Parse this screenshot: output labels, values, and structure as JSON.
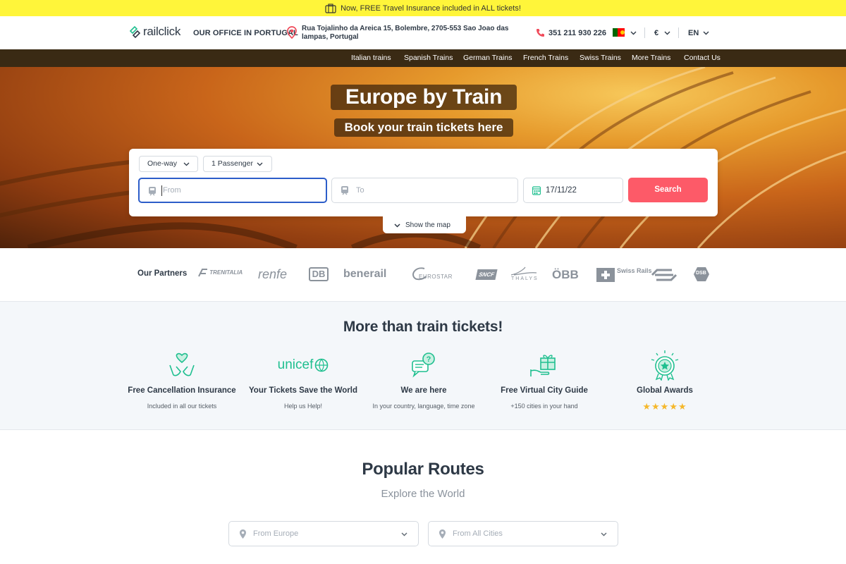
{
  "promo": {
    "text": "Now, FREE Travel Insurance included in ALL tickets!"
  },
  "header": {
    "logo": "railclick",
    "office_label": "OUR OFFICE IN PORTUGAL",
    "office_address": "Rua Tojalinho da Areica 15, Bolembre, 2705-553 Sao Joao das lampas, Portugal",
    "phone": "351 211 930 226",
    "currency": "€",
    "language": "EN"
  },
  "nav": {
    "items": [
      "Italian trains",
      "Spanish Trains",
      "German Trains",
      "French Trains",
      "Swiss Trains",
      "More Trains",
      "Contact Us"
    ]
  },
  "hero": {
    "title": "Europe by Train",
    "subtitle": "Book your train tickets here"
  },
  "search": {
    "trip_type": "One-way",
    "passengers": "1 Passenger",
    "from_placeholder": "From",
    "to_placeholder": "To",
    "date": "17/11/22",
    "button": "Search",
    "show_map": "Show the map"
  },
  "partners": {
    "label": "Our Partners",
    "logos": [
      "TRENITALIA",
      "renfe",
      "DB",
      "benerail",
      "EUROSTAR",
      "SNCF",
      "THALYS",
      "ÖBB",
      "Swiss Rails",
      "NS",
      "DSB"
    ]
  },
  "features": {
    "title": "More than train tickets!",
    "items": [
      {
        "title": "Free Cancellation Insurance",
        "subtitle": "Included in all our tickets",
        "icon": "hands-heart-icon"
      },
      {
        "title": "Your Tickets Save the World",
        "subtitle": "Help us Help!",
        "icon": "unicef-logo"
      },
      {
        "title": "We are here",
        "subtitle": "In your country, language, time zone",
        "icon": "chat-question-icon"
      },
      {
        "title": "Free Virtual City Guide",
        "subtitle": "+150 cities in your hand",
        "icon": "gift-hand-icon"
      },
      {
        "title": "Global Awards",
        "subtitle": "",
        "icon": "award-icon",
        "rating": 5
      }
    ],
    "unicef_word": "unicef"
  },
  "routes": {
    "title": "Popular Routes",
    "subtitle": "Explore the World",
    "region_placeholder": "From Europe",
    "city_placeholder": "From All Cities"
  },
  "colors": {
    "promo_bg": "#fff53a",
    "nav_bg": "#3a2a14",
    "accent": "#fd5a68",
    "teal": "#1fbf8f",
    "active_border": "#2c5dc9"
  }
}
